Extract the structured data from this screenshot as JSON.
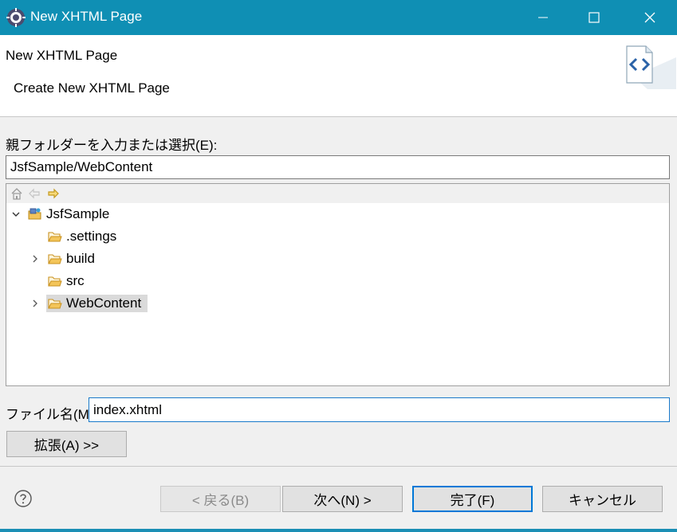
{
  "window": {
    "title": "New XHTML Page"
  },
  "header": {
    "title": "New XHTML Page",
    "subtitle": "Create New XHTML Page"
  },
  "parent_folder": {
    "label": "親フォルダーを入力または選択(E):",
    "value": "JsfSample/WebContent"
  },
  "tree": {
    "root": "JsfSample",
    "items": [
      {
        "label": ".settings",
        "expandable": false,
        "selected": false
      },
      {
        "label": "build",
        "expandable": true,
        "selected": false
      },
      {
        "label": "src",
        "expandable": false,
        "selected": false
      },
      {
        "label": "WebContent",
        "expandable": true,
        "selected": true
      }
    ]
  },
  "file_name": {
    "label": "ファイル名(M):",
    "value": "index.xhtml"
  },
  "buttons": {
    "advanced": "拡張(A) >>",
    "back": "< 戻る(B)",
    "next": "次へ(N) >",
    "finish": "完了(F)",
    "cancel": "キャンセル"
  },
  "icons": [
    "eclipse-logo-icon",
    "minimize-icon",
    "maximize-icon",
    "close-icon",
    "xhtml-file-icon",
    "home-icon",
    "back-arrow-icon",
    "forward-arrow-icon",
    "project-icon",
    "folder-icon",
    "chevron-down-icon",
    "chevron-right-icon",
    "help-icon"
  ],
  "colors": {
    "titlebar": "#0f8fb4",
    "focus": "#0078d7",
    "folder": "#e8a317"
  }
}
